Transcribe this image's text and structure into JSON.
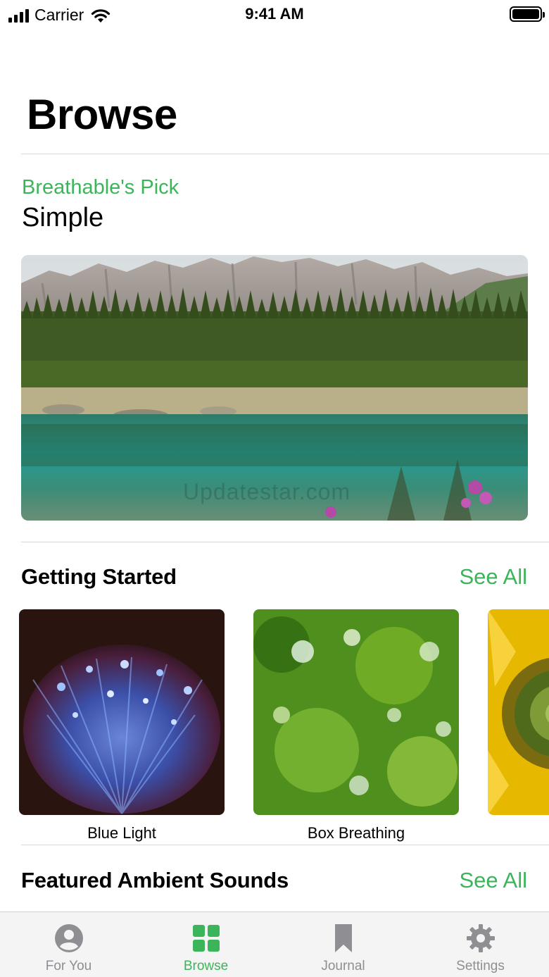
{
  "status_bar": {
    "carrier": "Carrier",
    "time": "9:41 AM"
  },
  "header": {
    "title": "Browse"
  },
  "featured": {
    "eyebrow": "Breathable's Pick",
    "title": "Simple",
    "watermark": "Updatestar.com"
  },
  "getting_started": {
    "title": "Getting Started",
    "see_all": "See All",
    "items": [
      {
        "label": "Blue Light"
      },
      {
        "label": "Box Breathing"
      }
    ]
  },
  "ambient": {
    "title": "Featured Ambient Sounds",
    "see_all": "See All"
  },
  "tab_bar": {
    "tabs": [
      {
        "label": "For You",
        "icon": "person-icon"
      },
      {
        "label": "Browse",
        "icon": "grid-icon"
      },
      {
        "label": "Journal",
        "icon": "bookmark-icon"
      },
      {
        "label": "Settings",
        "icon": "gear-icon"
      }
    ],
    "active_index": 1
  },
  "colors": {
    "accent": "#3cb55a",
    "inactive": "#8e8e93"
  }
}
